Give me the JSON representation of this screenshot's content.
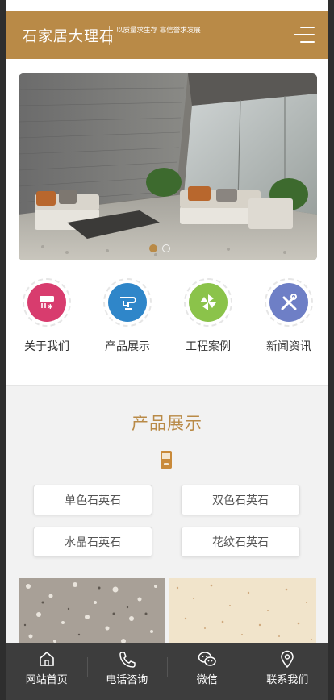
{
  "header": {
    "brand": "石家居大理石",
    "slogan": "以质量求生存 靠信誉求发展",
    "menu_icon": "hamburger-menu-icon"
  },
  "banner": {
    "slide_count": 2,
    "active_slide": 1
  },
  "nav": [
    {
      "label": "关于我们",
      "icon": "air-conditioner-icon",
      "color": "#d83c6e"
    },
    {
      "label": "产品展示",
      "icon": "faucet-icon",
      "color": "#2f86c9"
    },
    {
      "label": "工程案例",
      "icon": "pinwheel-icon",
      "color": "#8bc34a"
    },
    {
      "label": "新闻资讯",
      "icon": "tools-icon",
      "color": "#6e7fc6"
    }
  ],
  "products": {
    "title": "产品展示",
    "divider_icon": "phone-device-icon",
    "categories": [
      "单色石英石",
      "双色石英石",
      "水晶石英石",
      "花纹石英石"
    ]
  },
  "footer": [
    {
      "label": "网站首页",
      "icon": "home-icon"
    },
    {
      "label": "电话咨询",
      "icon": "phone-icon"
    },
    {
      "label": "微信",
      "icon": "wechat-icon"
    },
    {
      "label": "联系我们",
      "icon": "location-pin-icon"
    }
  ],
  "colors": {
    "accent": "#b98a47",
    "footer_bg": "#3d3d3d",
    "section_bg": "#f2f2f2"
  }
}
